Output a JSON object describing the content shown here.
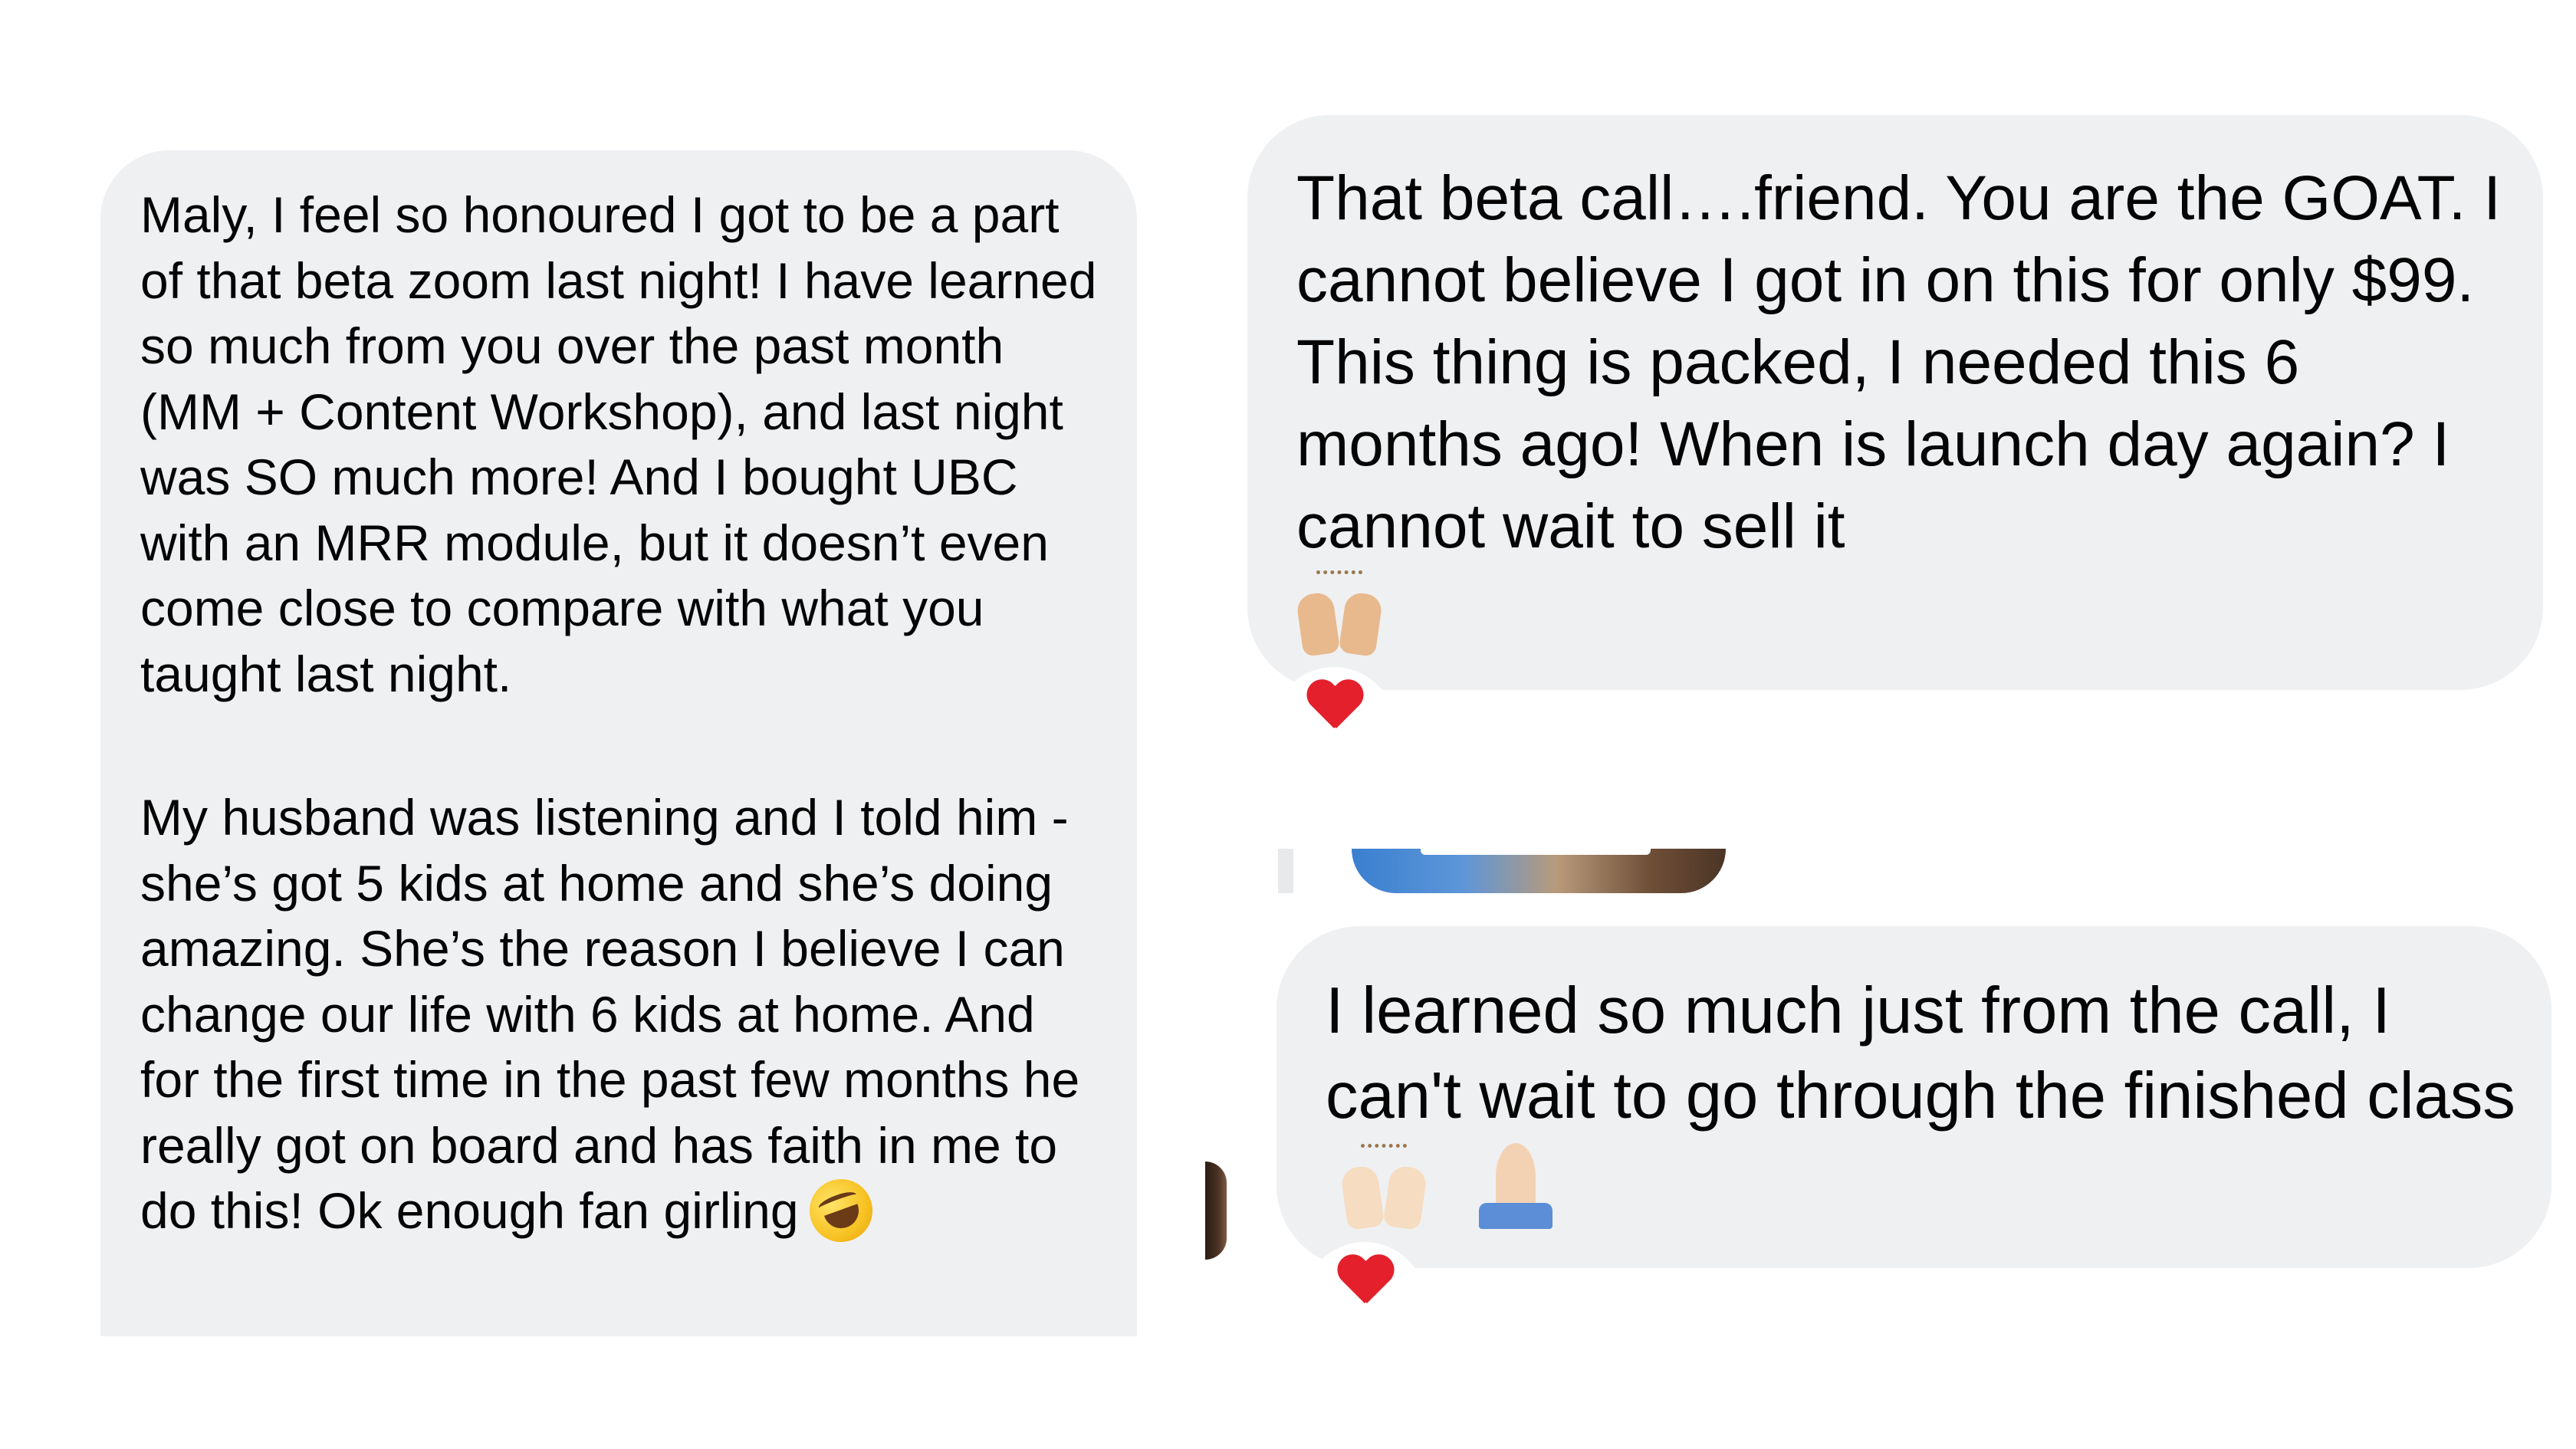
{
  "messages": {
    "left": {
      "paragraph1": "Maly, I feel so honoured I got to be a part of that beta zoom last night! I have learned so much from you over the past month (MM + Content Workshop), and last night was SO much more! And I bought UBC with an MRR module, but it doesn’t even come close to compare with what you taught last night.",
      "paragraph2": "My husband was listening and I told him - she’s got 5 kids at home and she’s doing amazing. She’s the reason I believe I can change our life with 6 kids at home. And for the first time in the past few months he really got on board and has faith in me to do this! Ok enough fan girling",
      "emoji": "rolling-on-floor-laughing"
    },
    "right_top": {
      "text": "That beta call….friend. You are the GOAT. I cannot believe I got in on this for only $99. This thing is packed, I needed this 6 months ago! When is launch day again? I cannot wait to sell it",
      "emoji": "raising-hands",
      "reaction": "heart"
    },
    "right_bottom": {
      "text": "I learned so much just from the call,  I can't wait to go through the finished class",
      "emojis": [
        "raising-hands",
        "folded-hands"
      ],
      "reaction": "heart"
    }
  },
  "colors": {
    "bubble": "#eff0f2",
    "text": "#050505",
    "heart": "#e3202c",
    "background": "#ffffff"
  }
}
